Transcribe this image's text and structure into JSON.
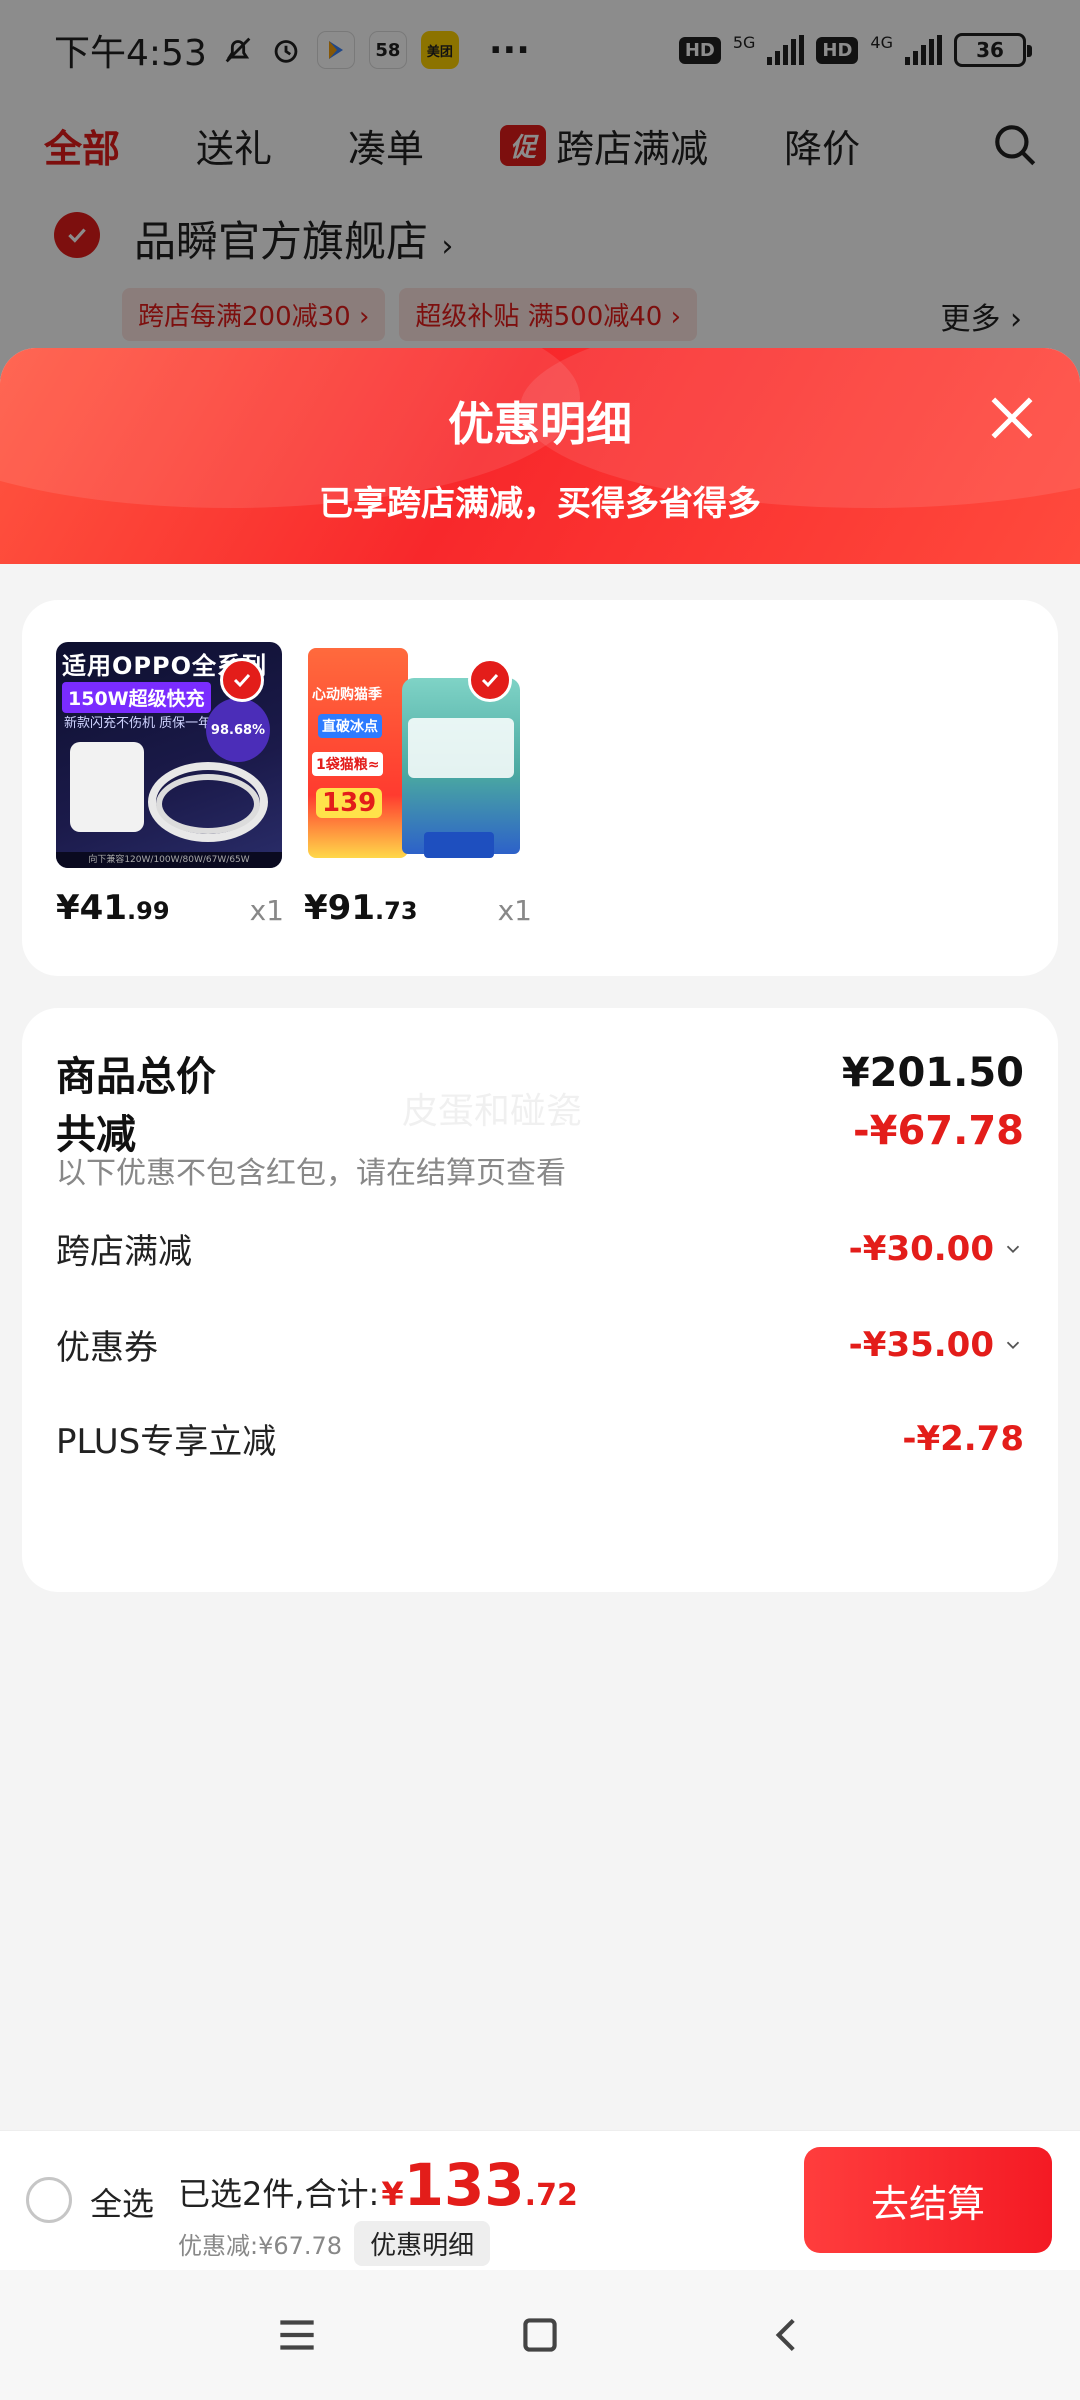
{
  "status_bar": {
    "time": "下午4:53",
    "app_icons": [
      "play-store-icon",
      "58-app-icon",
      "meituan-app-icon"
    ],
    "app_icon_labels": {
      "fifty_eight": "58",
      "meituan": "美团"
    },
    "more": "···",
    "hd1": "HD",
    "net1": "5G",
    "hd2": "HD",
    "net2": "4G",
    "battery": "36"
  },
  "bg_tabs": {
    "items": [
      "全部",
      "送礼",
      "凑单",
      "跨店满减",
      "降价"
    ],
    "promo_badge": "促"
  },
  "bg_store": {
    "name": "品瞬官方旗舰店",
    "name_chevron": "›",
    "chips": [
      "跨店每满200减30 ›",
      "超级补贴 满500减40 ›"
    ],
    "more": "更多 ›"
  },
  "sheet": {
    "title": "优惠明细",
    "subtitle": "已享跨店满减，买得多省得多"
  },
  "products": [
    {
      "price_symbol": "¥",
      "price_int": "41",
      "price_dec": ".99",
      "qty": "x1",
      "image_text": {
        "banner": "适用OPPO全系列",
        "tag": "150W超级快充",
        "tagline": "新款闪充不伤机  质保一年",
        "badge": "98.68%",
        "foot": "向下兼容120W/100W/80W/67W/65W"
      }
    },
    {
      "price_symbol": "¥",
      "price_int": "91",
      "price_dec": ".73",
      "qty": "x1",
      "image_text": {
        "t1": "心动购猫季",
        "t2": "直破冰点",
        "t3": "1袋猫粮≈",
        "price": "139"
      }
    }
  ],
  "summary": {
    "total_label": "商品总价",
    "total_value": "¥201.50",
    "discount_label": "共减",
    "discount_value": "-¥67.78",
    "note": "以下优惠不包含红包，请在结算页查看",
    "watermark": "皮蛋和碰瓷",
    "lines": [
      {
        "label": "跨店满减",
        "value": "-¥30.00",
        "expandable": true
      },
      {
        "label": "优惠券",
        "value": "-¥35.00",
        "expandable": true
      },
      {
        "label": "PLUS专享立减",
        "value": "-¥2.78",
        "expandable": false
      }
    ]
  },
  "bottom_bar": {
    "select_all": "全选",
    "selected_text": "已选2件,合计:",
    "total_symbol": "¥",
    "total_int": "133",
    "total_dec": ".72",
    "discount_text": "优惠减:¥67.78",
    "detail_chip": "优惠明细",
    "checkout": "去结算"
  },
  "colors": {
    "accent": "#e31d1a",
    "header_gradient_start": "#ff5640",
    "header_gradient_end": "#f8282b"
  },
  "nav_icons": [
    "menu-icon",
    "home-square-icon",
    "back-icon"
  ]
}
